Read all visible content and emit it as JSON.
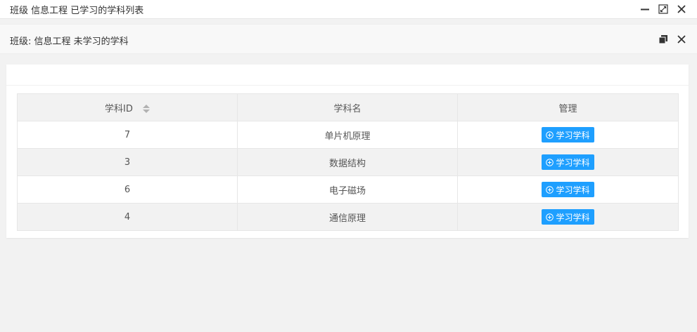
{
  "outer_window": {
    "title": "班级 信息工程 已学习的学科列表"
  },
  "inner_window": {
    "title": "班级: 信息工程 未学习的学科"
  },
  "table": {
    "headers": {
      "id": "学科ID",
      "name": "学科名",
      "manage": "管理"
    },
    "rows": [
      {
        "id": "7",
        "name": "单片机原理",
        "action": "学习学科"
      },
      {
        "id": "3",
        "name": "数据结构",
        "action": "学习学科"
      },
      {
        "id": "6",
        "name": "电子磁场",
        "action": "学习学科"
      },
      {
        "id": "4",
        "name": "通信原理",
        "action": "学习学科"
      }
    ]
  },
  "colors": {
    "primary_button": "#1e9fff",
    "page_background": "#f2f2f2"
  }
}
